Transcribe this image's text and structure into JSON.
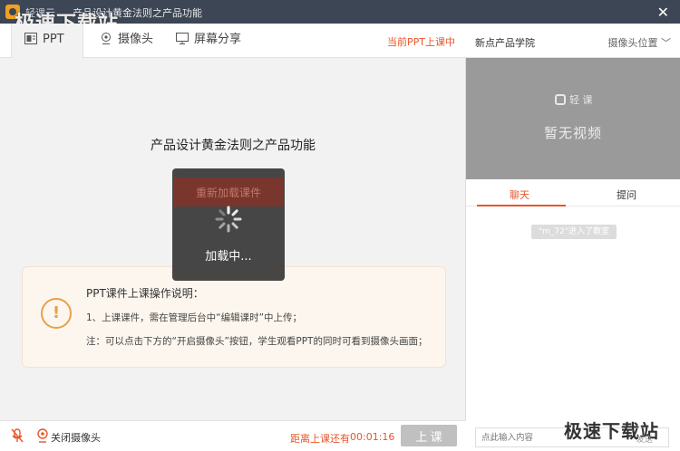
{
  "window": {
    "app_name": "轻课云",
    "title": "产品设计黄金法则之产品功能",
    "close_symbol": "✕"
  },
  "watermark": {
    "top": "极速下载站",
    "bottom": "极速下载站"
  },
  "tabs": {
    "ppt": "PPT",
    "camera": "摄像头",
    "screen_share": "屏幕分享",
    "status": "当前PPT上课中"
  },
  "ppt": {
    "title": "产品设计黄金法则之产品功能",
    "reload_label": "重新加载课件",
    "loading_text": "加载中..."
  },
  "help": {
    "icon_symbol": "!",
    "title": "PPT课件上课操作说明：",
    "line1": "1、上课课件，需在管理后台中“编辑课时”中上传；",
    "line2": "注：可以点击下方的“开启摄像头”按钮，学生观看PPT的同时可看到摄像头画面；"
  },
  "bottombar": {
    "close_camera": "关闭摄像头",
    "countdown_label": "距离上课还有",
    "countdown_time": "00:01:16",
    "start_class": "上 课"
  },
  "side": {
    "institution": "新点产品学院",
    "camera_position": "摄像头位置 ﹀",
    "logo_text": "轻 课",
    "no_video": "暂无视频",
    "chat_tab": "聊天",
    "question_tab": "提问",
    "join_notice": "\"m_72\"进入了教室",
    "input_placeholder": "点此输入内容",
    "send_hint": "发送"
  },
  "colors": {
    "titlebar": "#3c4655",
    "accent": "#e8562a",
    "warning": "#e4a24b"
  }
}
